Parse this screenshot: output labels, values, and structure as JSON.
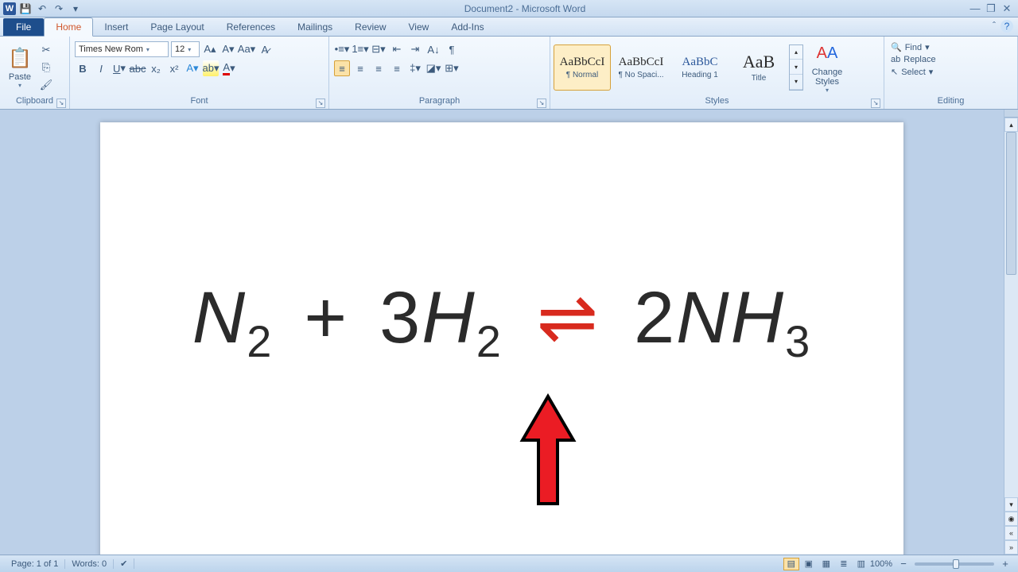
{
  "app": {
    "title": "Document2 - Microsoft Word"
  },
  "qat": {
    "save": "💾",
    "undo": "↶",
    "redo": "↷"
  },
  "tabs": {
    "file": "File",
    "items": [
      "Home",
      "Insert",
      "Page Layout",
      "References",
      "Mailings",
      "Review",
      "View",
      "Add-Ins"
    ],
    "active": "Home"
  },
  "ribbon": {
    "clipboard": {
      "label": "Clipboard",
      "paste": "Paste"
    },
    "font": {
      "label": "Font",
      "name": "Times New Rom",
      "size": "12"
    },
    "paragraph": {
      "label": "Paragraph"
    },
    "styles": {
      "label": "Styles",
      "items": [
        {
          "preview": "AaBbCcI",
          "name": "¶ Normal"
        },
        {
          "preview": "AaBbCcI",
          "name": "¶ No Spaci..."
        },
        {
          "preview": "AaBbC",
          "name": "Heading 1"
        },
        {
          "preview": "AaB",
          "name": "Title"
        }
      ],
      "change": "Change Styles"
    },
    "editing": {
      "label": "Editing",
      "find": "Find",
      "replace": "Replace",
      "select": "Select"
    }
  },
  "document": {
    "equation": {
      "n": "N",
      "two": "2",
      "plus": "+",
      "three": "3",
      "h": "H",
      "equil": "⇌",
      "nh": "NH",
      "three2": "3",
      "coeff2": "2"
    }
  },
  "status": {
    "page": "Page: 1 of 1",
    "words": "Words: 0",
    "zoom": "100%"
  }
}
